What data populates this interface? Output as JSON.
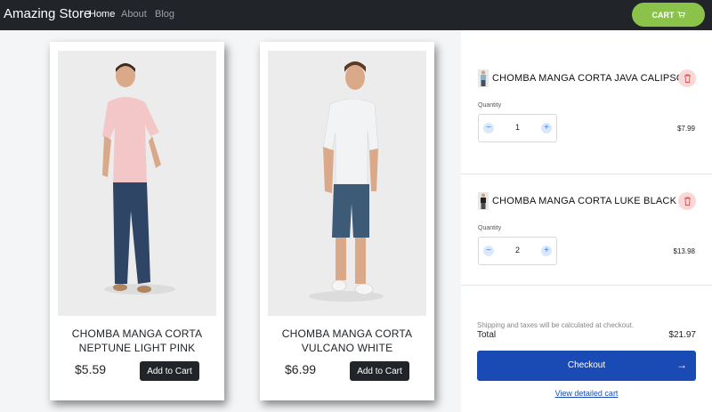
{
  "navbar": {
    "brand": "Amazing Store",
    "links": [
      "Home",
      "About",
      "Blog"
    ],
    "cart_label": "CART"
  },
  "products": [
    {
      "title_line1": "CHOMBA MANGA CORTA",
      "title_line2": "NEPTUNE LIGHT PINK",
      "price": "$5.59",
      "button": "Add to Cart",
      "shirt_color": "#f3c7c7",
      "pants_color": "#2e4566"
    },
    {
      "title_line1": "CHOMBA MANGA CORTA",
      "title_line2": "VULCANO WHITE",
      "price": "$6.99",
      "button": "Add to Cart",
      "shirt_color": "#f2f3f5",
      "pants_color": "#3d5a77"
    }
  ],
  "cart": {
    "items": [
      {
        "name": "CHOMBA MANGA CORTA JAVA CALIPSO",
        "quantity_label": "Quantity",
        "quantity": "1",
        "price": "$7.99",
        "minus": "−",
        "plus": "+"
      },
      {
        "name": "CHOMBA MANGA CORTA LUKE BLACK",
        "quantity_label": "Quantity",
        "quantity": "2",
        "price": "$13.98",
        "minus": "−",
        "plus": "+"
      }
    ],
    "shipping_note": "Shipping and taxes will be calculated at checkout.",
    "total_label": "Total",
    "total_value": "$21.97",
    "checkout_label": "Checkout",
    "checkout_arrow": "→",
    "view_cart_label": "View detailed cart"
  },
  "colors": {
    "navbar_bg": "#212529",
    "cart_button": "#8bc34a",
    "checkout_button": "#1a4bb5",
    "trash_bg": "#f8d7d7"
  },
  "icons": {
    "cart": "cart-icon",
    "trash": "trash-icon",
    "arrow": "arrow-right-icon"
  }
}
